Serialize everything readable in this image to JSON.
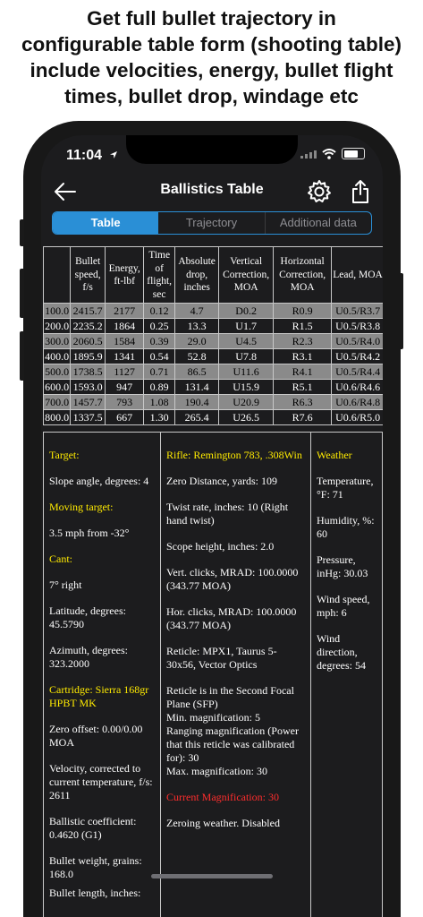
{
  "caption": "Get full bullet trajectory in\nconfigurable table form (shooting table)\ninclude velocities, energy, bullet flight\ntimes, bullet drop, windage etc",
  "status": {
    "time": "11:04"
  },
  "nav": {
    "title": "Ballistics Table"
  },
  "tabs": [
    "Table",
    "Trajectory",
    "Additional data"
  ],
  "table": {
    "headers": [
      "",
      "Bullet speed, f/s",
      "Energy, ft-lbf",
      "Time of flight, sec",
      "Absolute drop, inches",
      "Vertical Correction, MOA",
      "Horizontal Correction, MOA",
      "Lead, MOA"
    ],
    "rows": [
      [
        "100.0",
        "2415.7",
        "2177",
        "0.12",
        "4.7",
        "D0.2",
        "R0.9",
        "U0.5/R3.7"
      ],
      [
        "200.0",
        "2235.2",
        "1864",
        "0.25",
        "13.3",
        "U1.7",
        "R1.5",
        "U0.5/R3.8"
      ],
      [
        "300.0",
        "2060.5",
        "1584",
        "0.39",
        "29.0",
        "U4.5",
        "R2.3",
        "U0.5/R4.0"
      ],
      [
        "400.0",
        "1895.9",
        "1341",
        "0.54",
        "52.8",
        "U7.8",
        "R3.1",
        "U0.5/R4.2"
      ],
      [
        "500.0",
        "1738.5",
        "1127",
        "0.71",
        "86.5",
        "U11.6",
        "R4.1",
        "U0.5/R4.4"
      ],
      [
        "600.0",
        "1593.0",
        "947",
        "0.89",
        "131.4",
        "U15.9",
        "R5.1",
        "U0.6/R4.6"
      ],
      [
        "700.0",
        "1457.7",
        "793",
        "1.08",
        "190.4",
        "U20.9",
        "R6.3",
        "U0.6/R4.8"
      ],
      [
        "800.0",
        "1337.5",
        "667",
        "1.30",
        "265.4",
        "U26.5",
        "R7.6",
        "U0.6/R5.0"
      ]
    ]
  },
  "info": {
    "col1": {
      "target_title": "Target:",
      "slope": "Slope angle, degrees: 4",
      "moving_title": "Moving target:",
      "moving": "3.5 mph from -32°",
      "cant_title": "Cant:",
      "cant": "7° right",
      "latitude": "Latitude, degrees: 45.5790",
      "azimuth": "Azimuth, degrees: 323.2000",
      "cartridge_title": "Cartridge: Sierra 168gr HPBT MK",
      "zero_offset": "Zero offset: 0.00/0.00 MOA",
      "velocity": "Velocity, corrected to current temperature, f/s: 2611",
      "bc": "Ballistic coefficient: 0.4620 (G1)",
      "weight": "Bullet weight, grains: 168.0",
      "length": "Bullet length, inches:"
    },
    "col2": {
      "rifle_title": "Rifle: Remington 783, .308Win",
      "zero_distance": "Zero Distance, yards: 109",
      "twist": "Twist rate, inches: 10 (Right hand twist)",
      "scope_height": "Scope height, inches: 2.0",
      "vert_clicks": "Vert. clicks, MRAD: 100.0000 (343.77 MOA)",
      "hor_clicks": "Hor. clicks, MRAD: 100.0000 (343.77 MOA)",
      "reticle": "Reticle: MPX1, Taurus 5-30x56, Vector Optics",
      "sfp": "Reticle is in the Second Focal Plane (SFP)",
      "min_mag": "Min. magnification: 5",
      "ranging_mag": "Ranging magnification (Power that this reticle was calibrated for): 30",
      "max_mag": "Max. magnification: 30",
      "current_mag": "Current Magnification: 30",
      "zeroing": "Zeroing weather. Disabled"
    },
    "col3": {
      "weather_title": "Weather",
      "temperature": "Temperature, °F: 71",
      "humidity": "Humidity, %: 60",
      "pressure": "Pressure, inHg: 30.03",
      "wind_speed": "Wind speed, mph: 6",
      "wind_direction": "Wind direction, degrees: 54"
    }
  },
  "colors": {
    "accent": "#2a8fd6",
    "highlight": "#ffeb00",
    "alert": "#ff2d2d",
    "alt_row": "#8a8a8a"
  },
  "icons": [
    "back-arrow-icon",
    "gear-icon",
    "share-icon",
    "wifi-icon",
    "signal-icon",
    "battery-icon",
    "location-arrow-icon"
  ]
}
